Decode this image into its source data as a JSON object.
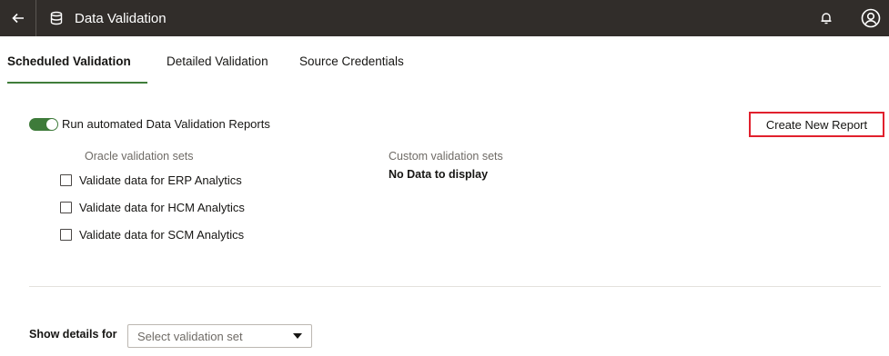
{
  "header": {
    "title": "Data Validation",
    "back_icon": "arrow-left-icon",
    "app_icon": "database-icon",
    "notification_icon": "bell-icon",
    "avatar_icon": "user-avatar-icon",
    "background_color": "#312d2a"
  },
  "tabs": [
    {
      "label": "Scheduled Validation",
      "active": true
    },
    {
      "label": "Detailed Validation",
      "active": false
    },
    {
      "label": "Source Credentials",
      "active": false
    }
  ],
  "toggle": {
    "label": "Run automated Data Validation Reports",
    "on": true,
    "color": "#3e7b3a"
  },
  "create_button": {
    "label": "Create New Report",
    "highlight_color": "#e1202d"
  },
  "oracle_sets": {
    "heading": "Oracle validation sets",
    "items": [
      {
        "label": "Validate data for ERP Analytics",
        "checked": false
      },
      {
        "label": "Validate data for HCM Analytics",
        "checked": false
      },
      {
        "label": "Validate data for SCM Analytics",
        "checked": false
      }
    ]
  },
  "custom_sets": {
    "heading": "Custom validation sets",
    "empty_text": "No Data to display"
  },
  "details": {
    "label": "Show details for",
    "select_placeholder": "Select validation set"
  }
}
